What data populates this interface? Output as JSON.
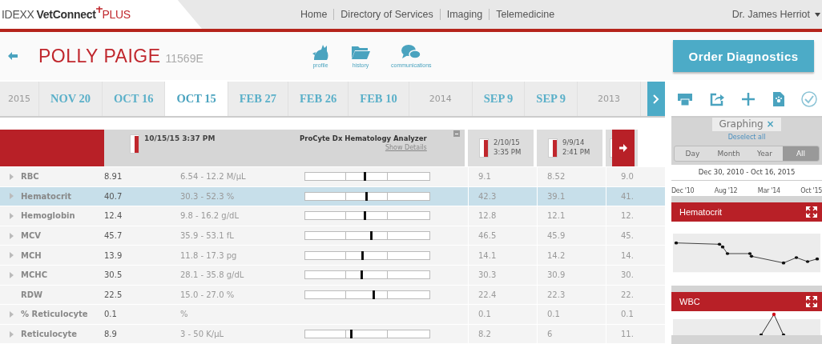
{
  "nav": {
    "logo": {
      "brand": "IDEXX",
      "product": "VetConnect",
      "suffix": "PLUS"
    },
    "links": [
      "Home",
      "Directory of Services",
      "Imaging",
      "Telemedicine"
    ],
    "user": "Dr. James Herriot"
  },
  "patient": {
    "name": "POLLY PAIGE",
    "id": "11569E"
  },
  "record_links": [
    {
      "label": "profile",
      "kind": "cat"
    },
    {
      "label": "history",
      "kind": "folder"
    },
    {
      "label": "communications",
      "kind": "chat"
    }
  ],
  "order_button": "Order Diagnostics",
  "timeline": [
    {
      "label": "2015",
      "kind": "year",
      "selected": false
    },
    {
      "label": "NOV 20",
      "kind": "date",
      "selected": false
    },
    {
      "label": "OCT 16",
      "kind": "date",
      "selected": false
    },
    {
      "label": "OCT 15",
      "kind": "date",
      "selected": true
    },
    {
      "label": "FEB 27",
      "kind": "date",
      "selected": false
    },
    {
      "label": "FEB 26",
      "kind": "date",
      "selected": false
    },
    {
      "label": "FEB 10",
      "kind": "date",
      "selected": false
    },
    {
      "label": "2014",
      "kind": "year",
      "selected": false
    },
    {
      "label": "SEP 9",
      "kind": "date",
      "selected": false
    },
    {
      "label": "SEP 9",
      "kind": "date",
      "selected": false
    },
    {
      "label": "2013",
      "kind": "year",
      "selected": false
    }
  ],
  "toolbar": [
    {
      "kind": "print"
    },
    {
      "kind": "share"
    },
    {
      "kind": "add"
    },
    {
      "kind": "document"
    },
    {
      "kind": "check"
    }
  ],
  "table": {
    "current": {
      "datetime": "10/15/15 3:37 PM",
      "analyzer": "ProCyte Dx Hematology Analyzer",
      "details_link": "Show Details"
    },
    "previous": [
      {
        "date": "2/10/15",
        "time": "3:35 PM"
      },
      {
        "date": "9/9/14",
        "time": "2:41 PM"
      }
    ],
    "rows": [
      {
        "name": "RBC",
        "value": "8.91",
        "range": "6.54 - 12.2 M/µL",
        "level": 0.48,
        "previous": [
          "9.1",
          "8.52",
          "9.0"
        ],
        "expandable": true,
        "selected": false
      },
      {
        "name": "Hematocrit",
        "value": "40.7",
        "range": "30.3 - 52.3 %",
        "level": 0.49,
        "previous": [
          "42.3",
          "39.1",
          "41."
        ],
        "expandable": true,
        "selected": true
      },
      {
        "name": "Hemoglobin",
        "value": "12.4",
        "range": "9.8 - 16.2 g/dL",
        "level": 0.48,
        "previous": [
          "12.8",
          "12.1",
          "12."
        ],
        "expandable": true,
        "selected": false
      },
      {
        "name": "MCV",
        "value": "45.7",
        "range": "35.9 - 53.1 fL",
        "level": 0.53,
        "previous": [
          "46.5",
          "45.9",
          "45."
        ],
        "expandable": true,
        "selected": false
      },
      {
        "name": "MCH",
        "value": "13.9",
        "range": "11.8 - 17.3 pg",
        "level": 0.46,
        "previous": [
          "14.1",
          "14.2",
          "14."
        ],
        "expandable": true,
        "selected": false
      },
      {
        "name": "MCHC",
        "value": "30.5",
        "range": "28.1 - 35.8 g/dL",
        "level": 0.45,
        "previous": [
          "30.3",
          "30.9",
          "30."
        ],
        "expandable": true,
        "selected": false
      },
      {
        "name": "RDW",
        "value": "22.5",
        "range": "15.0 - 27.0 %",
        "level": 0.55,
        "previous": [
          "22.4",
          "22.3",
          "22."
        ],
        "expandable": false,
        "selected": false
      },
      {
        "name": "% Reticulocyte",
        "value": "0.1",
        "range": "%",
        "previous": [
          "0.1",
          "0.1",
          "0.1"
        ],
        "expandable": true,
        "selected": false
      },
      {
        "name": "Reticulocyte",
        "value": "8.9",
        "range": "3 - 50 K/µL",
        "level": 0.37,
        "previous": [
          "8.2",
          "6",
          "11."
        ],
        "expandable": true,
        "selected": false
      }
    ]
  },
  "graphing": {
    "tag": "Graphing",
    "close": "×",
    "deselect": "Deselect all",
    "periods": [
      {
        "label": "Day",
        "selected": false
      },
      {
        "label": "Month",
        "selected": false
      },
      {
        "label": "Year",
        "selected": false
      },
      {
        "label": "All",
        "selected": true
      }
    ],
    "range": "Dec 30, 2010 - Oct 16, 2015",
    "axis_labels": [
      "Dec '10",
      "Aug '12",
      "Mar '14",
      "Oct '15"
    ],
    "graphs": [
      "Hematocrit",
      "WBC"
    ]
  }
}
